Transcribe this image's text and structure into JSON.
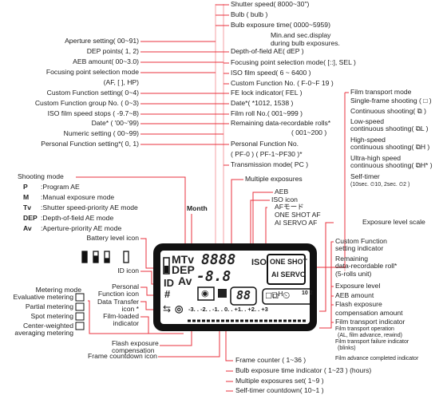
{
  "left_list": [
    "Aperture setting( 00~91)",
    "DEP points( 1, 2)",
    "AEB amount( 00~3.0)",
    "Focusing point selection mode",
    "(AF, [ ], HP)",
    "Custom Function setting( 0~4)",
    "Custom Function group No. ( 0~3)",
    "ISO film speed stops ( -9.7~8)",
    "Date* ( '00~'99)",
    "Numeric setting ( 00~99)",
    "Personal Function setting*( 0, 1)"
  ],
  "top_right_list": [
    "Shutter speed( 8000~30\")",
    "Bulb ( bulb )",
    "Bulb exposure time( 0000~5959)",
    "Min.and sec.display",
    "during bulb exposures.",
    "Depth-of-field AE( dEP )",
    "Focusing point selection mode( [::], SEL )",
    "ISO film speed( 6 ~ 6400 )",
    "Custom Function No. ( F-0~F 19 )",
    "FE lock indicator( FEL )",
    "Date*( *1012, 1538 )",
    "Film roll No.( 001~999 )",
    "Remaining data-recordable rolls*",
    "( 001~200 )",
    "Personal Function No.",
    "( PF-0 ) ( PF-1~PF30 )*",
    "Transmission mode( PC )"
  ],
  "film_transport": [
    "Film transport mode",
    "Single-frame shooting ( □ )",
    "Continuous shooting( ⧉ )",
    "Low-speed",
    "continuous shooting( ⧉L )",
    "High-speed",
    "continuous shooting( ⧉H )",
    "Ultra-high speed",
    "continuous shooting( ⧉H* )",
    "Self-timer",
    "(10sec. ⏲10, 2sec. ⏲2 )"
  ],
  "mid_labels": {
    "multiple": "Multiple exposures",
    "aeb": "AEB",
    "iso_icon": "ISO icon",
    "af_mode": "AFモード",
    "one_shot": "ONE  SHOT  AF",
    "ai_servo": "AI    SERVO  AF",
    "month": "Month"
  },
  "shooting": {
    "title": "Shooting mode",
    "modes": [
      {
        "sym": "P",
        "desc": ":Program AE"
      },
      {
        "sym": "M",
        "desc": ":Manual exposure mode"
      },
      {
        "sym": "Tv",
        "desc": ":Shutter speed-priority AE mode"
      },
      {
        "sym": "DEP",
        "desc": ":Depth-of-field AE mode"
      },
      {
        "sym": "Av",
        "desc": ":Aperture-priority AE mode"
      }
    ]
  },
  "left_lower": {
    "battery": "Battery level icon",
    "id": "ID icon",
    "personal": [
      "Personal",
      "Function icon"
    ],
    "data_transfer": [
      "Data Transfer",
      "icon *"
    ],
    "film_loaded": [
      "Film-loaded",
      "indicator"
    ],
    "metering": "Metering mode",
    "metering_modes": [
      "Evaluative metering",
      "Partial metering",
      "Spot metering",
      "Center-weighted",
      "averaging metering"
    ],
    "flash_comp": [
      "Flash exposure",
      "compensation"
    ],
    "frame_countdown": "Frame countdown icon"
  },
  "right_labels": {
    "scale": "Exposure level scale",
    "cf": [
      "Custom Function",
      "setting indicator"
    ],
    "remaining": [
      "Remaining",
      "data-recordable roll*",
      "(5-rolls unit)"
    ],
    "exp_level": "Exposure level",
    "aeb_amount": "AEB amount",
    "flash": [
      "Flash exposure",
      "compensation amount"
    ],
    "film_ind": "Film transport indicator",
    "film_sub": [
      "Film transport operation",
      "(AL, film advance, rewind)",
      "Film transport failure indicator",
      "(blinks)"
    ],
    "advance_done": "Film advance completed indicator"
  },
  "bottom": [
    "Frame counter ( 1~36 )",
    "Bulb exposure time indicator ( 1~23 ) (hours)",
    "Multiple exposures set( 1~9 )",
    "Self-timer countdown( 10~1 )"
  ],
  "lcd": {
    "mode1": "MTv",
    "mode2": "DEP",
    "mode3": "Av",
    "digits": "8888",
    "digits2": "-8.8",
    "iso": "ISO",
    "one_shot": "ONE SHOT",
    "ai_servo": "AI SERVO",
    "id": "ID",
    "hash": "#",
    "frame": "88",
    "timer": "10 2",
    "scale": "-3. . -2. . -1. . 0. . +1. . +2. . +3"
  },
  "colors": {
    "line": "#e8323c",
    "bus": "#f4a0a6",
    "lcd": "#111111"
  }
}
